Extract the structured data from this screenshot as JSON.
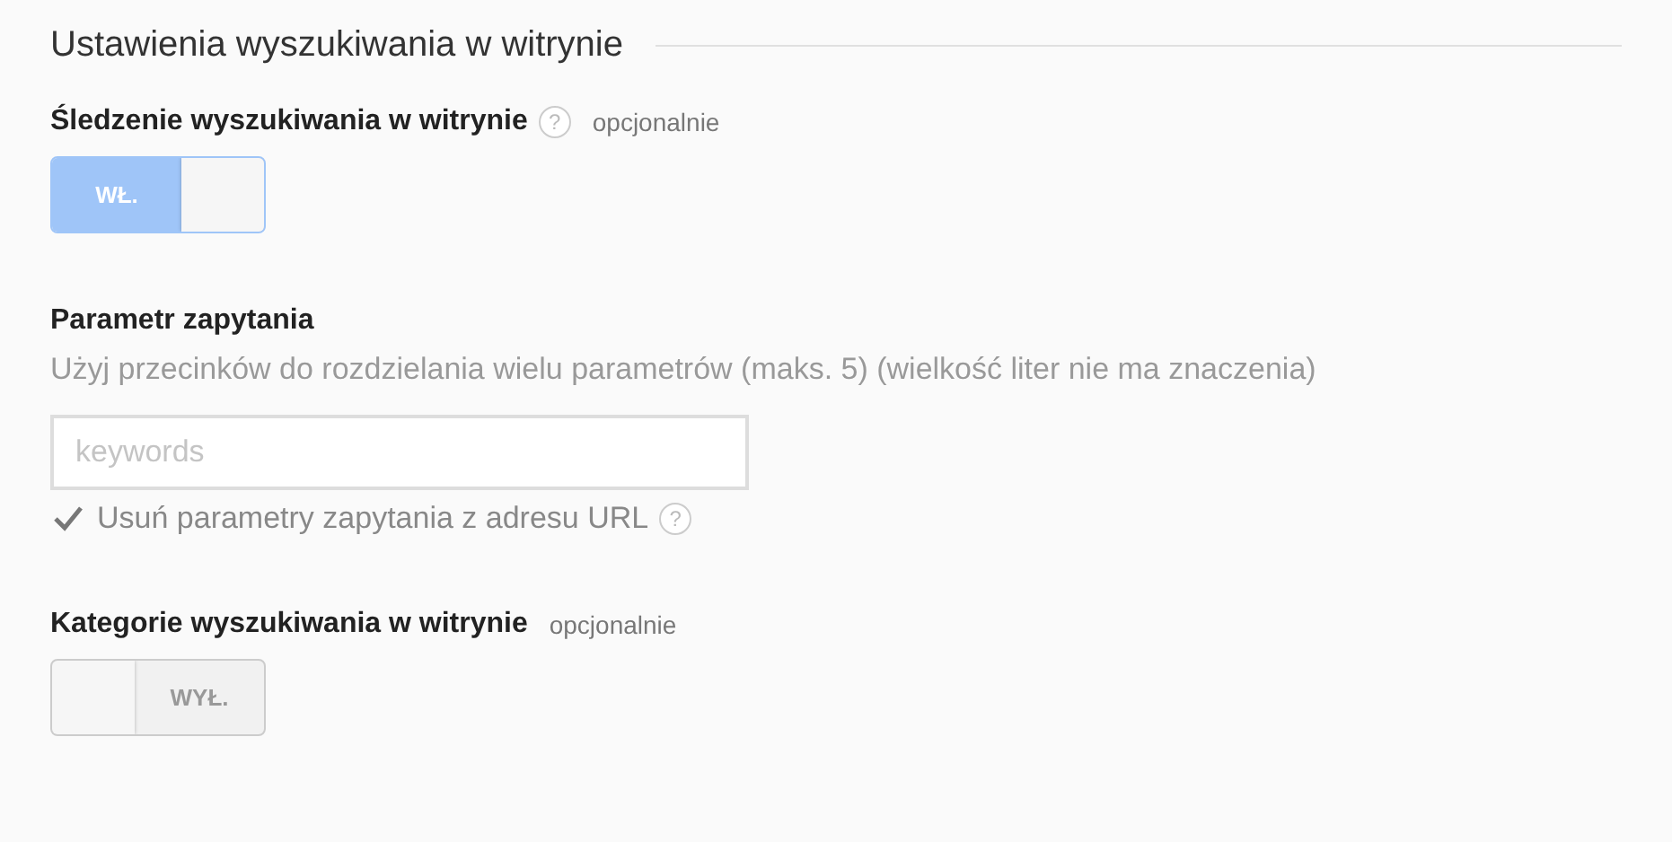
{
  "section_title": "Ustawienia wyszukiwania w witrynie",
  "site_search_tracking": {
    "label": "Śledzenie wyszukiwania w witrynie",
    "help": "?",
    "optional": "opcjonalnie",
    "toggle": {
      "on": true,
      "label": "WŁ."
    }
  },
  "query_parameter": {
    "label": "Parametr zapytania",
    "hint": "Użyj przecinków do rozdzielania wielu parametrów (maks. 5) (wielkość liter nie ma znaczenia)",
    "placeholder": "keywords",
    "strip": {
      "checked": true,
      "label": "Usuń parametry zapytania z adresu URL",
      "help": "?"
    }
  },
  "site_search_categories": {
    "label": "Kategorie wyszukiwania w witrynie",
    "optional": "opcjonalnie",
    "toggle": {
      "on": false,
      "label": "WYŁ."
    }
  }
}
